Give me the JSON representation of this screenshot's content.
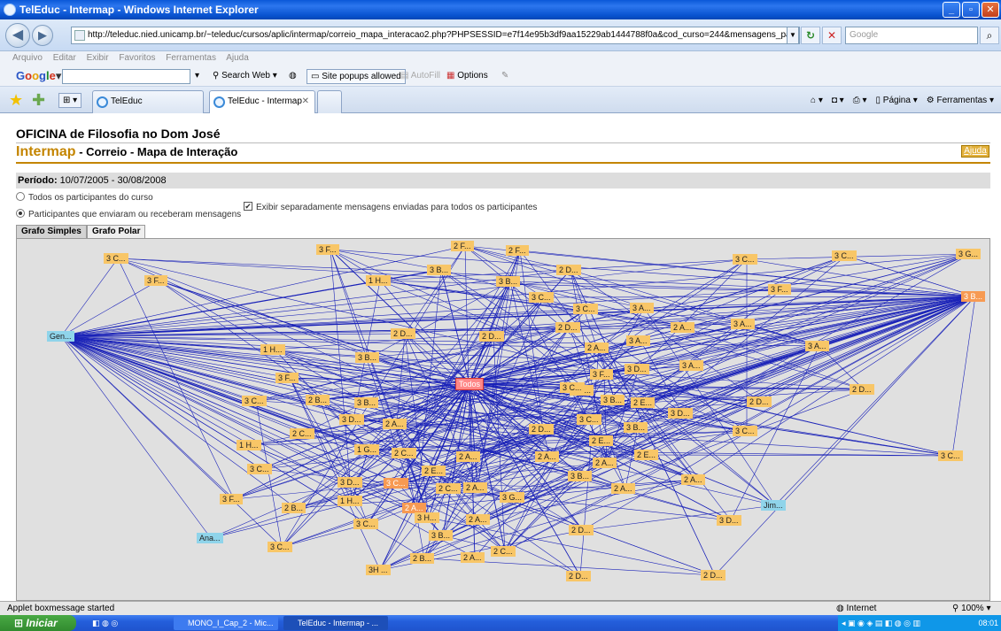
{
  "window": {
    "title": "TelEduc - Intermap - Windows Internet Explorer"
  },
  "addressbar": {
    "url": "http://teleduc.nied.unicamp.br/~teleduc/cursos/aplic/intermap/correio_mapa_interacao2.php?PHPSESSID=e7f14e95b3df9aa15229ab1444788f0a&cod_curso=244&mensagens_para_todos=sim&apresentaca",
    "search_placeholder": "Google"
  },
  "menu": {
    "items": [
      "Arquivo",
      "Editar",
      "Exibir",
      "Favoritos",
      "Ferramentas",
      "Ajuda"
    ]
  },
  "googlebar": {
    "logo": "Google",
    "search_web": "Search Web",
    "popups": "Site popups allowed",
    "autofill": "AutoFill",
    "options": "Options"
  },
  "tabs": [
    {
      "label": "TelEduc"
    },
    {
      "label": "TelEduc - Intermap"
    }
  ],
  "commandbar": {
    "pagina": "Página",
    "ferramentas": "Ferramentas"
  },
  "page": {
    "title": "OFICINA de Filosofia no Dom José",
    "app": "Intermap",
    "subtitle": " - Correio - Mapa de Interação",
    "help": "Ajuda",
    "periodo_label": "Período:",
    "periodo_value": " 10/07/2005 - 30/08/2008",
    "radio_all": "Todos os participantes do curso",
    "radio_participants": "Participantes que enviaram ou receberam mensagens",
    "checkbox_label": "Exibir separadamente mensagens enviadas para todos os participantes",
    "graph_tab_simple": "Grafo Simples",
    "graph_tab_polar": "Grafo Polar"
  },
  "graph": {
    "line_color": "#1a22b8",
    "nodes": [
      {
        "label": "3 C...",
        "kind": "y"
      },
      {
        "label": "3 F...",
        "kind": "y"
      },
      {
        "label": "3 F...",
        "kind": "y"
      },
      {
        "label": "2 F...",
        "kind": "y"
      },
      {
        "label": "2 F...",
        "kind": "y"
      },
      {
        "label": "3 B...",
        "kind": "y"
      },
      {
        "label": "1 H...",
        "kind": "y"
      },
      {
        "label": "3 B...",
        "kind": "y"
      },
      {
        "label": "2 D...",
        "kind": "y"
      },
      {
        "label": "3 C...",
        "kind": "y"
      },
      {
        "label": "3 C...",
        "kind": "y"
      },
      {
        "label": "3 G...",
        "kind": "y"
      },
      {
        "label": "3 F...",
        "kind": "y"
      },
      {
        "label": "3 C...",
        "kind": "y"
      },
      {
        "label": "3 C...",
        "kind": "y"
      },
      {
        "label": "3 A...",
        "kind": "y"
      },
      {
        "label": "3 B...",
        "kind": "o"
      },
      {
        "label": "Gen...",
        "kind": "c"
      },
      {
        "label": "2 D...",
        "kind": "y"
      },
      {
        "label": "2 D...",
        "kind": "y"
      },
      {
        "label": "2 D...",
        "kind": "y"
      },
      {
        "label": "2 A...",
        "kind": "y"
      },
      {
        "label": "3 A...",
        "kind": "y"
      },
      {
        "label": "3 A...",
        "kind": "y"
      },
      {
        "label": "1 H...",
        "kind": "y"
      },
      {
        "label": "3 B...",
        "kind": "y"
      },
      {
        "label": "2 A...",
        "kind": "y"
      },
      {
        "label": "3 A...",
        "kind": "y"
      },
      {
        "label": "3 A...",
        "kind": "y"
      },
      {
        "label": "3 F...",
        "kind": "y"
      },
      {
        "label": "3 F...",
        "kind": "y"
      },
      {
        "label": "3 D...",
        "kind": "y"
      },
      {
        "label": "3 B...",
        "kind": "y"
      },
      {
        "label": "Todos",
        "kind": "t"
      },
      {
        "label": "3 C...",
        "kind": "y"
      },
      {
        "label": "2 D...",
        "kind": "y"
      },
      {
        "label": "3 C...",
        "kind": "y"
      },
      {
        "label": "2 B...",
        "kind": "y"
      },
      {
        "label": "3 B...",
        "kind": "y"
      },
      {
        "label": "3 B...",
        "kind": "y"
      },
      {
        "label": "2 E...",
        "kind": "y"
      },
      {
        "label": "2 D...",
        "kind": "y"
      },
      {
        "label": "3 D...",
        "kind": "y"
      },
      {
        "label": "3 D...",
        "kind": "y"
      },
      {
        "label": "2 A...",
        "kind": "y"
      },
      {
        "label": "3 C...",
        "kind": "y"
      },
      {
        "label": "2 D...",
        "kind": "y"
      },
      {
        "label": "3 B...",
        "kind": "y"
      },
      {
        "label": "2 C...",
        "kind": "y"
      },
      {
        "label": "2 E...",
        "kind": "y"
      },
      {
        "label": "3 C...",
        "kind": "y"
      },
      {
        "label": "1 H...",
        "kind": "y"
      },
      {
        "label": "1 G...",
        "kind": "y"
      },
      {
        "label": "2 C...",
        "kind": "y"
      },
      {
        "label": "2 A...",
        "kind": "y"
      },
      {
        "label": "2 A...",
        "kind": "y"
      },
      {
        "label": "2 A...",
        "kind": "y"
      },
      {
        "label": "2 E...",
        "kind": "y"
      },
      {
        "label": "3 C...",
        "kind": "y"
      },
      {
        "label": "3 C...",
        "kind": "y"
      },
      {
        "label": "2 E...",
        "kind": "y"
      },
      {
        "label": "3 D...",
        "kind": "y"
      },
      {
        "label": "3 C...",
        "kind": "o"
      },
      {
        "label": "2 C...",
        "kind": "y"
      },
      {
        "label": "2 A...",
        "kind": "y"
      },
      {
        "label": "3 B...",
        "kind": "y"
      },
      {
        "label": "2 A...",
        "kind": "y"
      },
      {
        "label": "2 A...",
        "kind": "y"
      },
      {
        "label": "3 F...",
        "kind": "y"
      },
      {
        "label": "2 B...",
        "kind": "y"
      },
      {
        "label": "1 H...",
        "kind": "y"
      },
      {
        "label": "2 A...",
        "kind": "o"
      },
      {
        "label": "3 G...",
        "kind": "y"
      },
      {
        "label": "Jim...",
        "kind": "c"
      },
      {
        "label": "3 H...",
        "kind": "y"
      },
      {
        "label": "2 A...",
        "kind": "y"
      },
      {
        "label": "3 C...",
        "kind": "y"
      },
      {
        "label": "3 D...",
        "kind": "y"
      },
      {
        "label": "Ana...",
        "kind": "c"
      },
      {
        "label": "3 B...",
        "kind": "y"
      },
      {
        "label": "2 D...",
        "kind": "y"
      },
      {
        "label": "3 C...",
        "kind": "y"
      },
      {
        "label": "2 C...",
        "kind": "y"
      },
      {
        "label": "2 A...",
        "kind": "y"
      },
      {
        "label": "2 B...",
        "kind": "y"
      },
      {
        "label": "3H ...",
        "kind": "y"
      },
      {
        "label": "2 D...",
        "kind": "y"
      },
      {
        "label": "2 D...",
        "kind": "y"
      }
    ]
  },
  "status": {
    "text": "Applet boxmessage started",
    "zone": "Internet",
    "zoom": "100%"
  },
  "taskbar": {
    "start": "Iniciar",
    "items": [
      "MONO_I_Cap_2 - Mic...",
      "TelEduc - Intermap - ..."
    ],
    "clock": "08:01"
  }
}
